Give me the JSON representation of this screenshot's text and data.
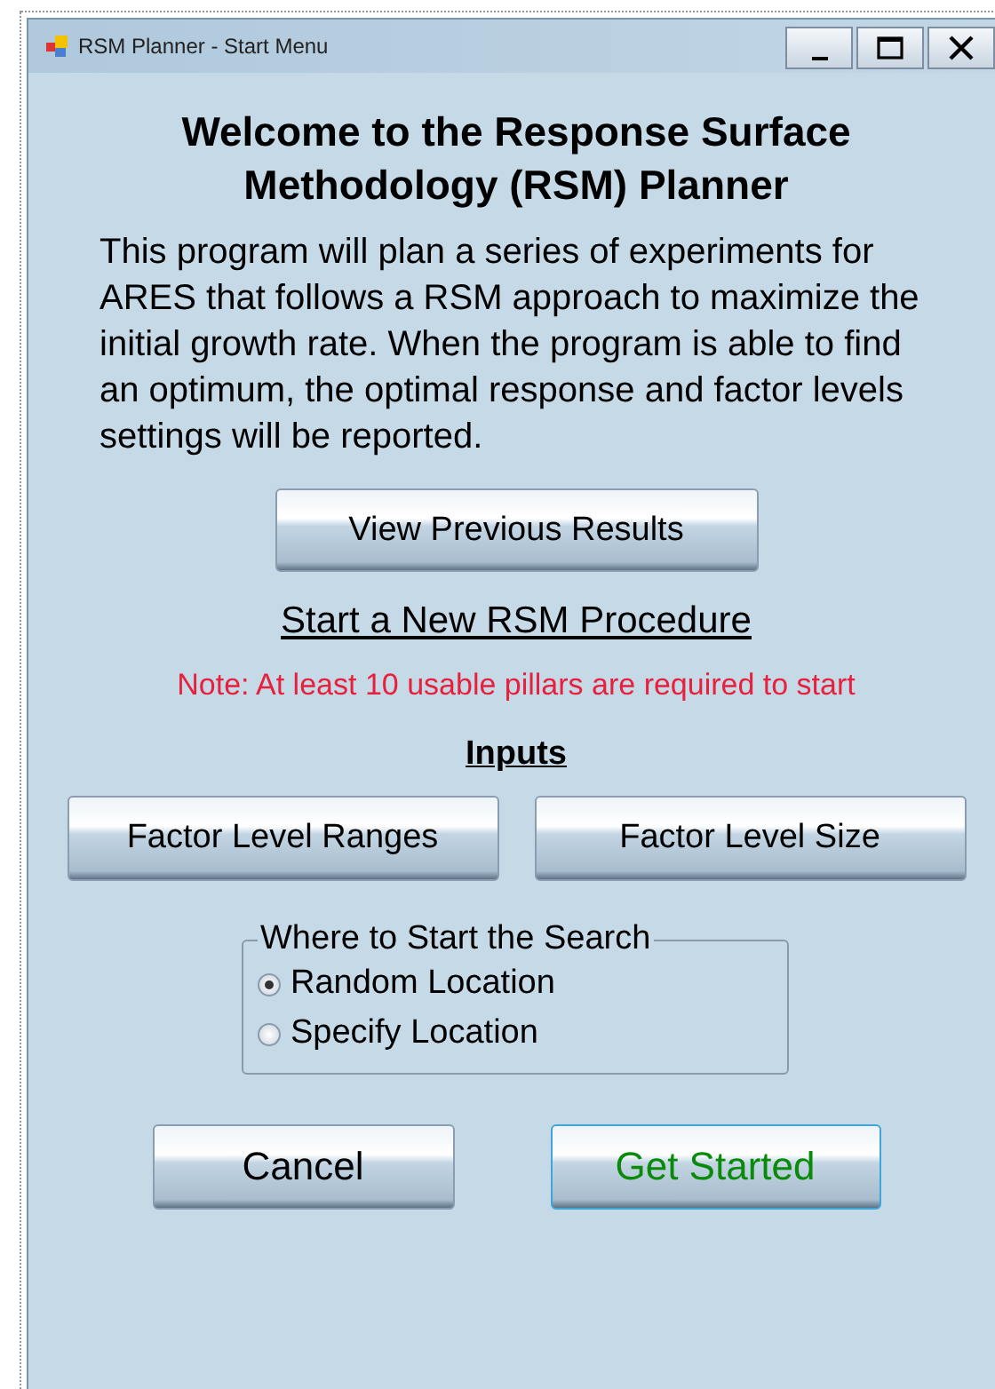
{
  "window": {
    "title": "RSM Planner - Start Menu"
  },
  "heading": "Welcome to the Response Surface Methodology (RSM) Planner",
  "description": "This program will plan a series of experiments for ARES that follows a RSM approach to maximize the initial growth rate. When the program is able to find an optimum, the optimal response and factor levels settings will be reported.",
  "view_button": "View Previous Results",
  "section_title": "Start a New RSM Procedure",
  "note": "Note: At least 10 usable pillars are required to start",
  "inputs_title": "Inputs",
  "input_buttons": [
    "Factor Level Ranges",
    "Factor Level Size"
  ],
  "start_group": {
    "title": "Where to Start the Search",
    "options": [
      {
        "label": "Random Location",
        "selected": true
      },
      {
        "label": "Specify Location",
        "selected": false
      }
    ]
  },
  "actions": [
    {
      "label": "Cancel",
      "kind": "normal"
    },
    {
      "label": "Get Started",
      "kind": "primary"
    }
  ]
}
